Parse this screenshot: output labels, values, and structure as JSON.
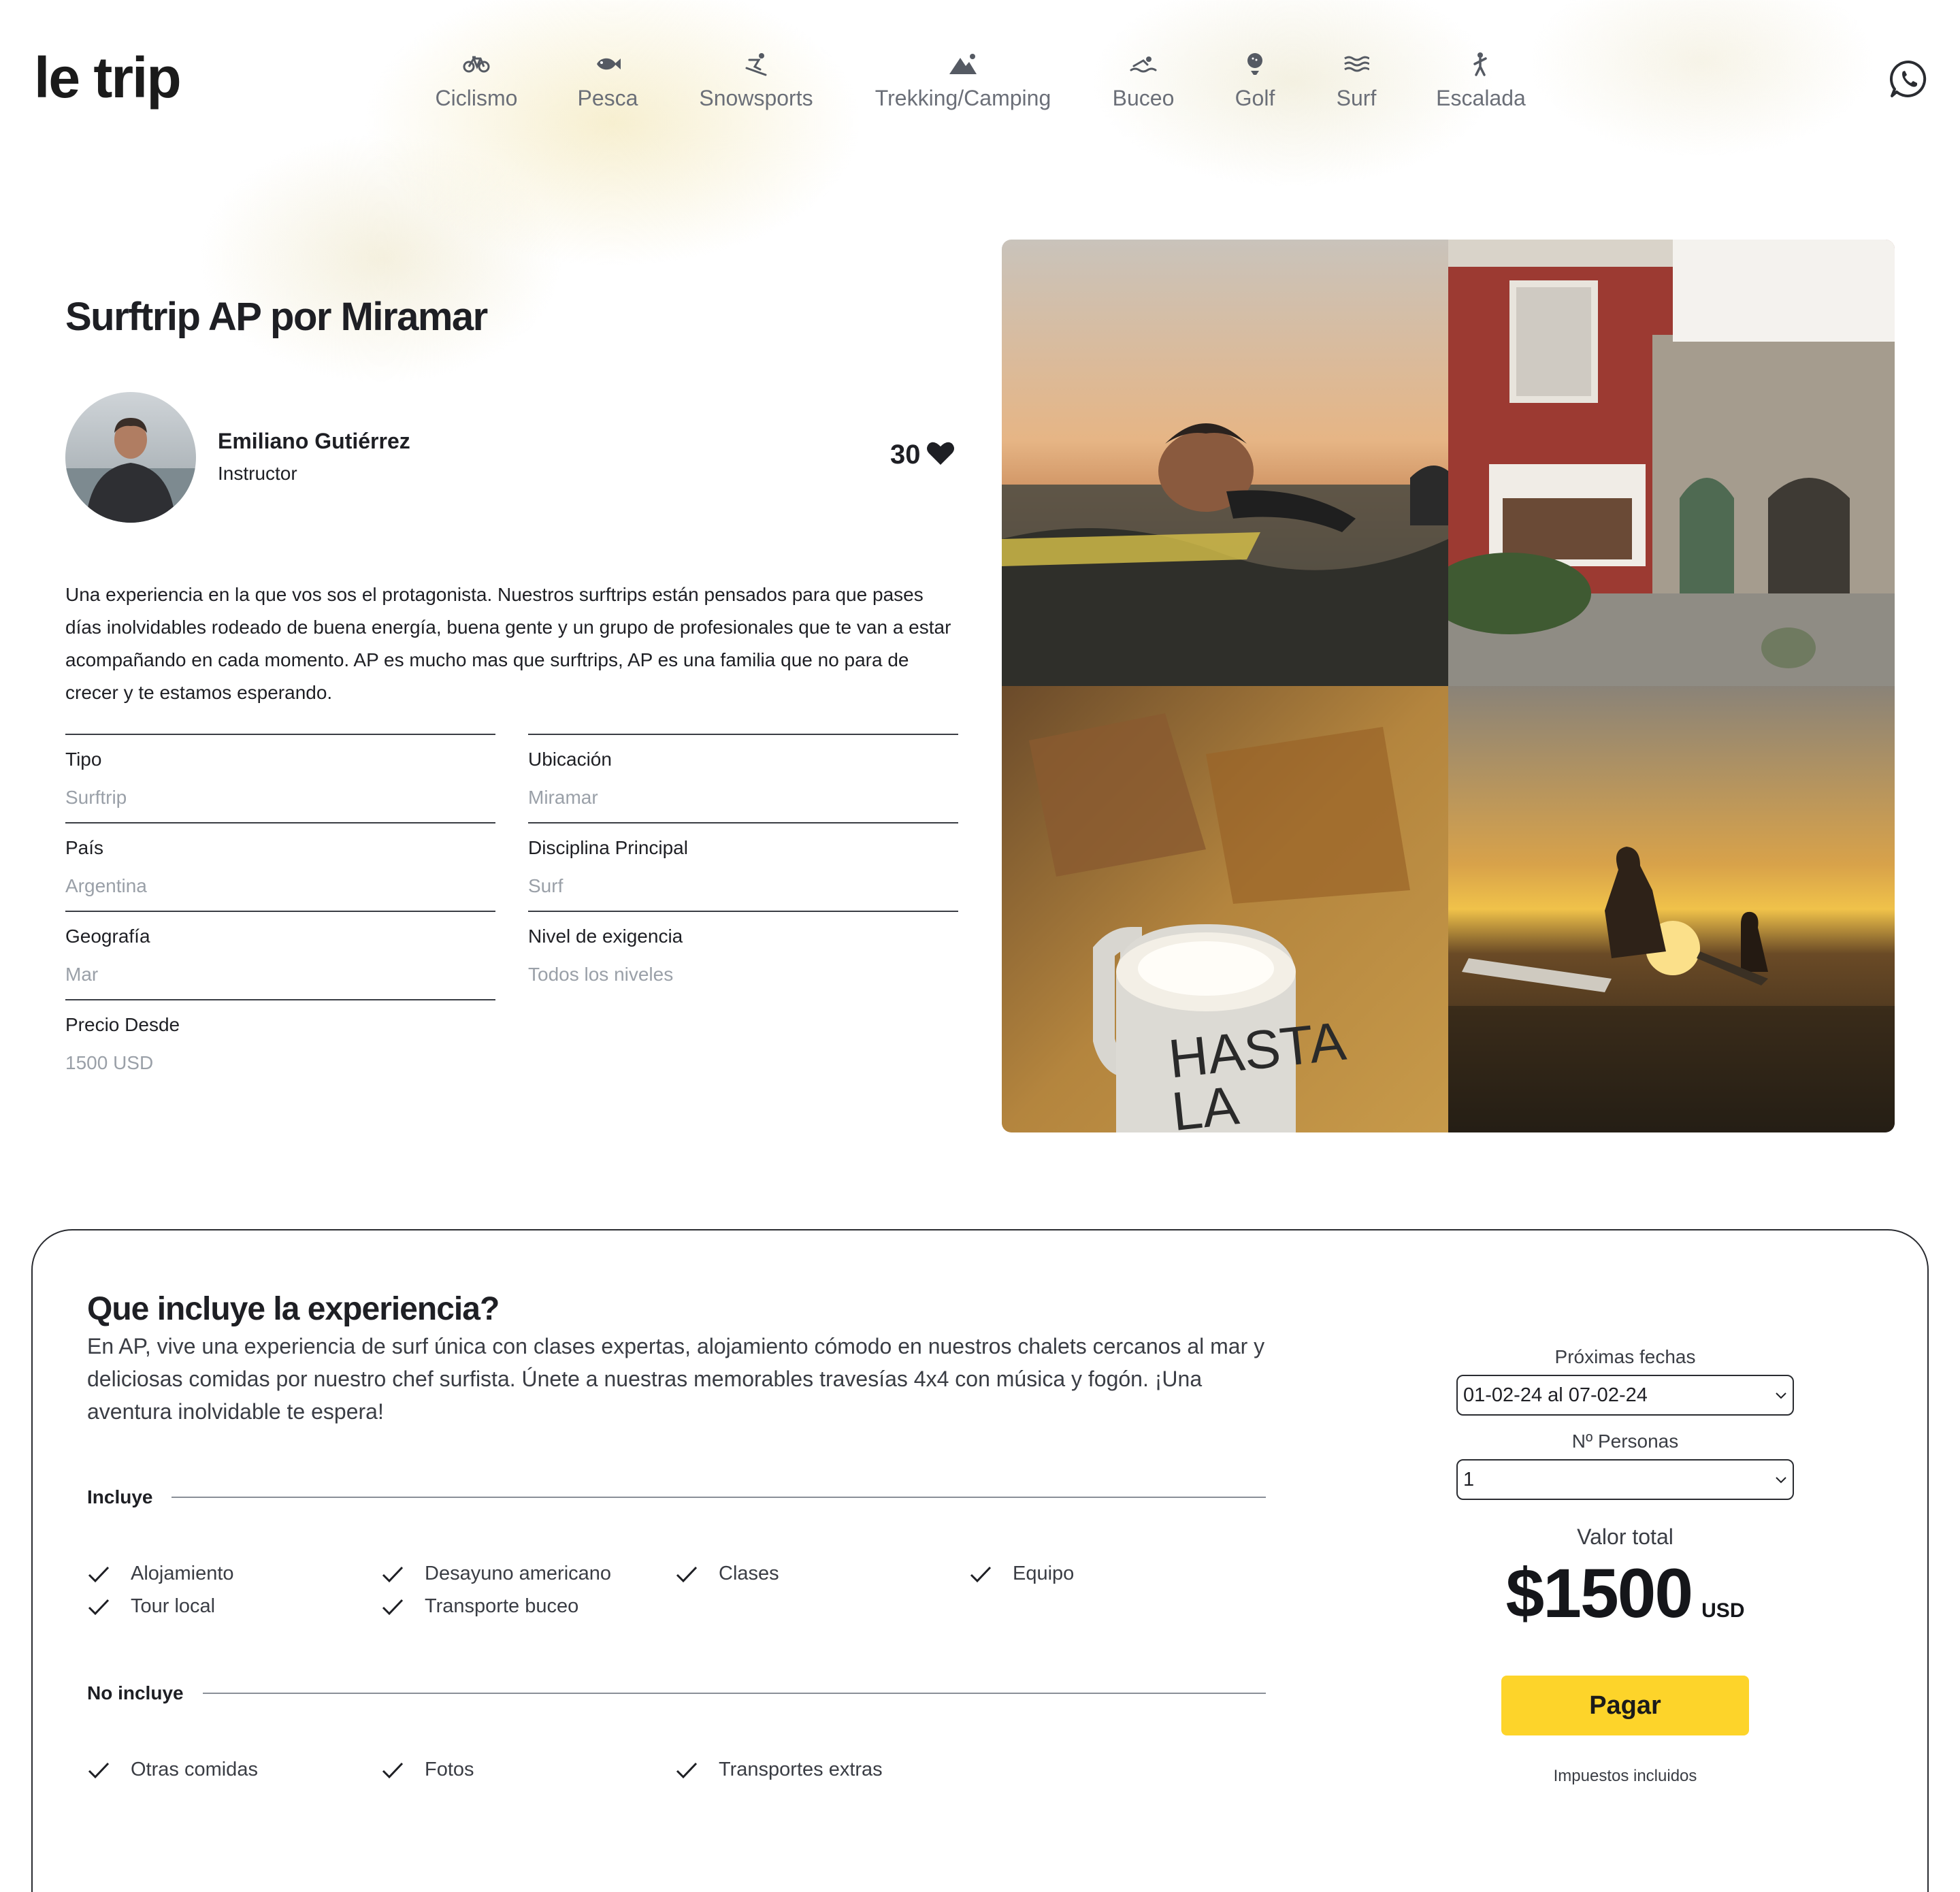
{
  "header": {
    "logo": "le trip",
    "nav": [
      {
        "label": "Ciclismo",
        "icon": "bicycle-icon"
      },
      {
        "label": "Pesca",
        "icon": "fish-icon"
      },
      {
        "label": "Snowsports",
        "icon": "skiing-icon"
      },
      {
        "label": "Trekking/Camping",
        "icon": "mountain-icon"
      },
      {
        "label": "Buceo",
        "icon": "swimmer-icon"
      },
      {
        "label": "Golf",
        "icon": "golf-ball-icon"
      },
      {
        "label": "Surf",
        "icon": "waves-icon"
      },
      {
        "label": "Escalada",
        "icon": "climber-icon"
      }
    ],
    "contact_icon": "whatsapp-icon"
  },
  "experience": {
    "title": "Surftrip AP por Miramar",
    "instructor": {
      "name": "Emiliano Gutiérrez",
      "role": "Instructor"
    },
    "likes": "30",
    "description": "Una experiencia en la que vos sos el protagonista. Nuestros surftrips están pensados para que pases días inolvidables rodeado de buena energía, buena gente y un grupo de profesionales que te van a estar acompañando en cada momento. AP es mucho mas que surftrips, AP es una familia que no para de crecer y te estamos esperando.",
    "fields": {
      "tipo": {
        "label": "Tipo",
        "value": "Surftrip"
      },
      "ubicacion": {
        "label": "Ubicación",
        "value": "Miramar"
      },
      "pais": {
        "label": "País",
        "value": "Argentina"
      },
      "disciplina": {
        "label": "Disciplina Principal",
        "value": "Surf"
      },
      "geografia": {
        "label": "Geografía",
        "value": "Mar"
      },
      "nivel": {
        "label": "Nivel de exigencia",
        "value": "Todos los niveles"
      },
      "precio": {
        "label": "Precio Desde",
        "value": "1500 USD"
      }
    },
    "gallery_mug_text": [
      "HASTA",
      "LA"
    ]
  },
  "includes_card": {
    "title": "Que incluye la experiencia?",
    "description": "En AP, vive una experiencia de surf única con clases expertas, alojamiento cómodo en nuestros chalets cercanos al mar y deliciosas comidas por nuestro chef surfista. Únete a nuestras memorables travesías 4x4 con música y fogón. ¡Una aventura inolvidable te espera!",
    "incluye_label": "Incluye",
    "incluye": [
      "Alojamiento",
      "Desayuno americano",
      "Clases",
      "Equipo",
      "Tour local",
      "Transporte buceo"
    ],
    "no_incluye_label": "No incluye",
    "no_incluye": [
      "Otras comidas",
      "Fotos",
      "Transportes extras"
    ]
  },
  "booking": {
    "dates_label": "Próximas fechas",
    "dates_value": "01-02-24 al 07-02-24",
    "people_label": "Nº Personas",
    "people_value": "1",
    "total_label": "Valor total",
    "total_amount": "$1500",
    "currency": "USD",
    "pay_label": "Pagar",
    "taxes_note": "Impuestos incluidos"
  },
  "colors": {
    "accent_yellow": "#fdd42a",
    "text_dark": "#1e1f24",
    "muted": "#9aa0a8"
  }
}
